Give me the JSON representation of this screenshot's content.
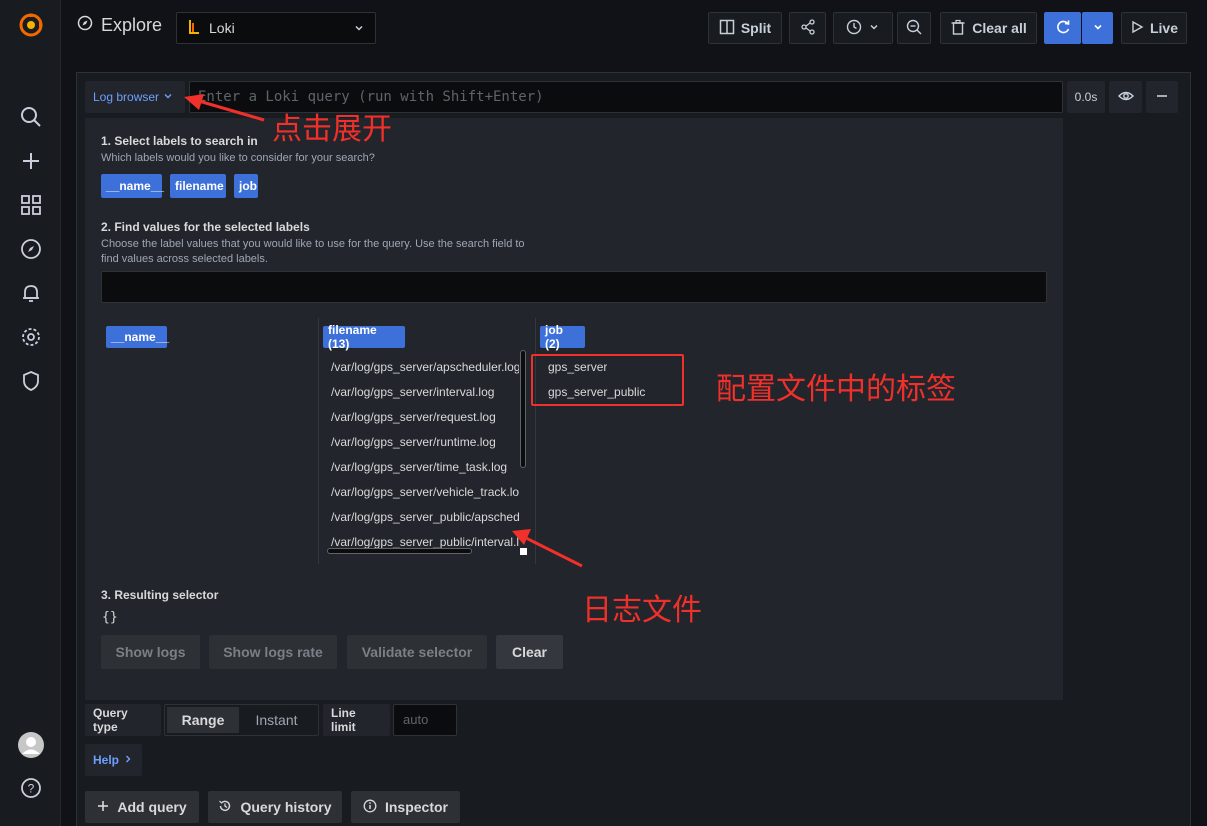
{
  "header": {
    "title": "Explore",
    "datasource": "Loki",
    "split_label": "Split",
    "clear_all_label": "Clear all",
    "live_label": "Live"
  },
  "query": {
    "log_browser_label": "Log browser",
    "placeholder": "Enter a Loki query (run with Shift+Enter)",
    "duration": "0.0s"
  },
  "browser": {
    "step1_title": "1. Select labels to search in",
    "step1_desc": "Which labels would you like to consider for your search?",
    "labels": [
      "__name__",
      "filename",
      "job"
    ],
    "step2_title": "2. Find values for the selected labels",
    "step2_desc_line1": "Choose the label values that you would like to use for the query. Use the search field to",
    "step2_desc_line2": "find values across selected labels.",
    "columns": [
      {
        "header": "__name__",
        "values": []
      },
      {
        "header": "filename (13)",
        "values": [
          "/var/log/gps_server/apscheduler.log",
          "/var/log/gps_server/interval.log",
          "/var/log/gps_server/request.log",
          "/var/log/gps_server/runtime.log",
          "/var/log/gps_server/time_task.log",
          "/var/log/gps_server/vehicle_track.log",
          "/var/log/gps_server_public/apscheduler.log",
          "/var/log/gps_server_public/interval.log"
        ]
      },
      {
        "header": "job (2)",
        "values": [
          "gps_server",
          "gps_server_public"
        ]
      }
    ],
    "step3_title": "3. Resulting selector",
    "selector": "{}",
    "buttons": [
      "Show logs",
      "Show logs rate",
      "Validate selector",
      "Clear"
    ]
  },
  "options": {
    "query_type_label": "Query type",
    "range_label": "Range",
    "instant_label": "Instant",
    "line_limit_label": "Line limit",
    "line_limit_placeholder": "auto"
  },
  "help_label": "Help",
  "bottom": {
    "add_query": "Add query",
    "query_history": "Query history",
    "inspector": "Inspector"
  },
  "annotations": {
    "expand": "点击展开",
    "labels_note": "配置文件中的标签",
    "logfiles_note": "日志文件"
  },
  "colors": {
    "accent": "#3d71d9",
    "annotation": "#f0302a"
  }
}
